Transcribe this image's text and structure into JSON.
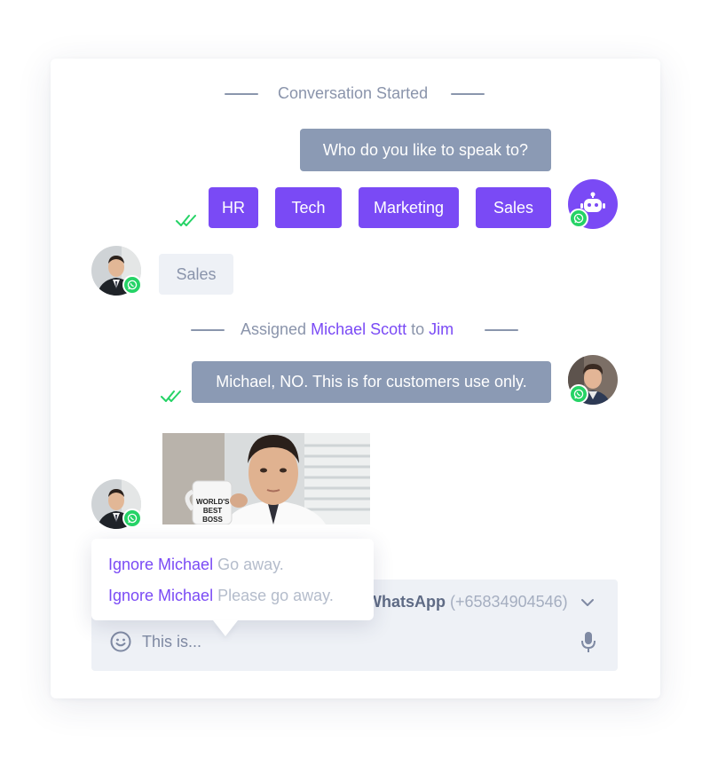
{
  "conversation": {
    "started_label": "Conversation Started",
    "bot_question": "Who do you like to speak to?",
    "options": [
      "HR",
      "Tech",
      "Marketing",
      "Sales"
    ],
    "customer_reply": "Sales",
    "assignment": {
      "prefix": "Assigned",
      "assignee": "Michael Scott",
      "connector": "to",
      "target": "Jim"
    },
    "agent_message": "Michael, NO. This is for customers use only.",
    "gif_mug_text": [
      "WORLD'S",
      "BEST",
      "BOSS"
    ]
  },
  "popup": {
    "suggestions": [
      {
        "name": "Ignore Michael",
        "message": "Go away."
      },
      {
        "name": "Ignore Michael",
        "message": "Please go away."
      }
    ]
  },
  "composer": {
    "channel_name": "WhatsApp",
    "channel_phone": "(+65834904546)",
    "input_text": "This is..."
  },
  "icons": {
    "emoji": "smiley-icon",
    "mic": "microphone-icon",
    "dropdown": "chevron-down-icon",
    "read_receipt": "double-check-icon",
    "channel_badge": "whatsapp-icon",
    "bot": "robot-icon"
  },
  "colors": {
    "accent": "#7a4af5",
    "bubble_gray": "#8b9ab4",
    "whatsapp_green": "#25d366",
    "composer_bg": "#eef1f6"
  }
}
